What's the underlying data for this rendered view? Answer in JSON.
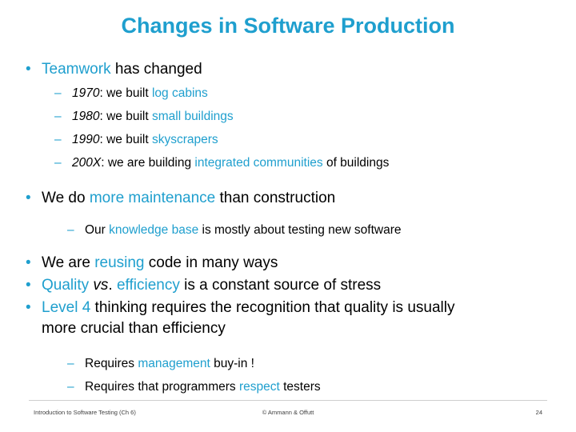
{
  "slide": {
    "title": "Changes in Software Production",
    "accent_color": "#1F9FCE",
    "bullets": {
      "b1": {
        "marker": "•",
        "part1": "Teamwork",
        "part2": " has changed"
      },
      "b1_subs": [
        {
          "marker": "–",
          "year": "1970",
          "mid": ": we built ",
          "highlight": "log cabins",
          "tail": ""
        },
        {
          "marker": "–",
          "year": "1980",
          "mid": ": we built ",
          "highlight": "small buildings",
          "tail": ""
        },
        {
          "marker": "–",
          "year": "1990",
          "mid": ": we built ",
          "highlight": "skyscrapers",
          "tail": ""
        },
        {
          "marker": "–",
          "year": "200X",
          "mid": ": we are building ",
          "highlight": "integrated communities",
          "tail": " of buildings"
        }
      ],
      "b2": {
        "marker": "•",
        "part1": "We do ",
        "highlight": "more maintenance",
        "part2": " than construction"
      },
      "b2_sub": {
        "marker": "–",
        "part1": "Our ",
        "highlight": "knowledge base",
        "part2": " is mostly about testing new software"
      },
      "b3": {
        "marker": "•",
        "part1": "We are ",
        "highlight": "reusing",
        "part2": " code in many ways"
      },
      "b4": {
        "marker": "•",
        "part1": "Quality ",
        "highlight_ital": "vs",
        "mid": ". ",
        "highlight2": "efficiency",
        "part2": " is a constant source of stress"
      },
      "b5": {
        "marker": "•",
        "highlight": "Level 4",
        "part1": " thinking requires the recognition that quality is usually",
        "part2": "more crucial than efficiency"
      },
      "b5_subs": [
        {
          "marker": "–",
          "part1": "Requires ",
          "highlight": "management",
          "part2": " buy-in !"
        },
        {
          "marker": "–",
          "part1": "Requires that programmers ",
          "highlight": "respect",
          "part2": " testers"
        }
      ]
    },
    "footer": {
      "left": "Introduction to Software Testing (Ch 6)",
      "center": "© Ammann & Offutt",
      "right": "24"
    }
  }
}
